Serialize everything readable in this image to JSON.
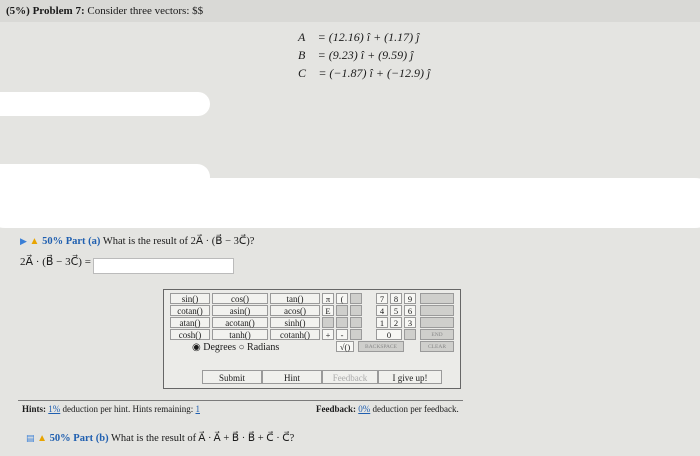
{
  "problem": {
    "heading": "(5%) Problem 7:",
    "prompt": "Consider three vectors: $$"
  },
  "vectors": {
    "a": "A⃗ = (12.16) î + (1.17) ĵ",
    "b": "B⃗ = (9.23) î + (9.59) ĵ",
    "c": "C⃗ = (−1.87) î + (−12.9) ĵ"
  },
  "part_a": {
    "percent": "50% Part (a)",
    "question": "What is the result of 2A⃗ · (B⃗ − 3C⃗)?",
    "answer_label": "2A⃗ · (B⃗ − 3C⃗) =",
    "answer_value": ""
  },
  "calculator": {
    "functions": [
      [
        "sin()",
        "cos()",
        "tan()"
      ],
      [
        "cotan()",
        "asin()",
        "acos()"
      ],
      [
        "atan()",
        "acotan()",
        "sinh()"
      ],
      [
        "cosh()",
        "tanh()",
        "cotanh()"
      ]
    ],
    "const_pi": "π",
    "const_e": "E",
    "paren_open": "(",
    "digits_row1": [
      "7",
      "8",
      "9"
    ],
    "digits_row2": [
      "4",
      "5",
      "6"
    ],
    "digits_row3": [
      "1",
      "2",
      "3"
    ],
    "zero": "0",
    "plus": "+",
    "minus": "-",
    "sqrt": "√()",
    "backspace": "BACKSPACE",
    "home": "HOME",
    "end": "END",
    "clear": "CLEAR",
    "degrees": "Degrees",
    "radians": "Radians",
    "submit": "Submit",
    "hint": "Hint",
    "feedback_btn": "Feedback",
    "give_up": "I give up!"
  },
  "hints": {
    "label": "Hints:",
    "deduction": "1%",
    "text": "deduction per hint. Hints remaining:",
    "remaining": "1"
  },
  "feedback": {
    "label": "Feedback:",
    "deduction": "0%",
    "text": "deduction per feedback."
  },
  "part_b": {
    "percent": "50% Part (b)",
    "question": "What is the result of A⃗ · A⃗ + B⃗ · B⃗ + C⃗ · C⃗?"
  }
}
